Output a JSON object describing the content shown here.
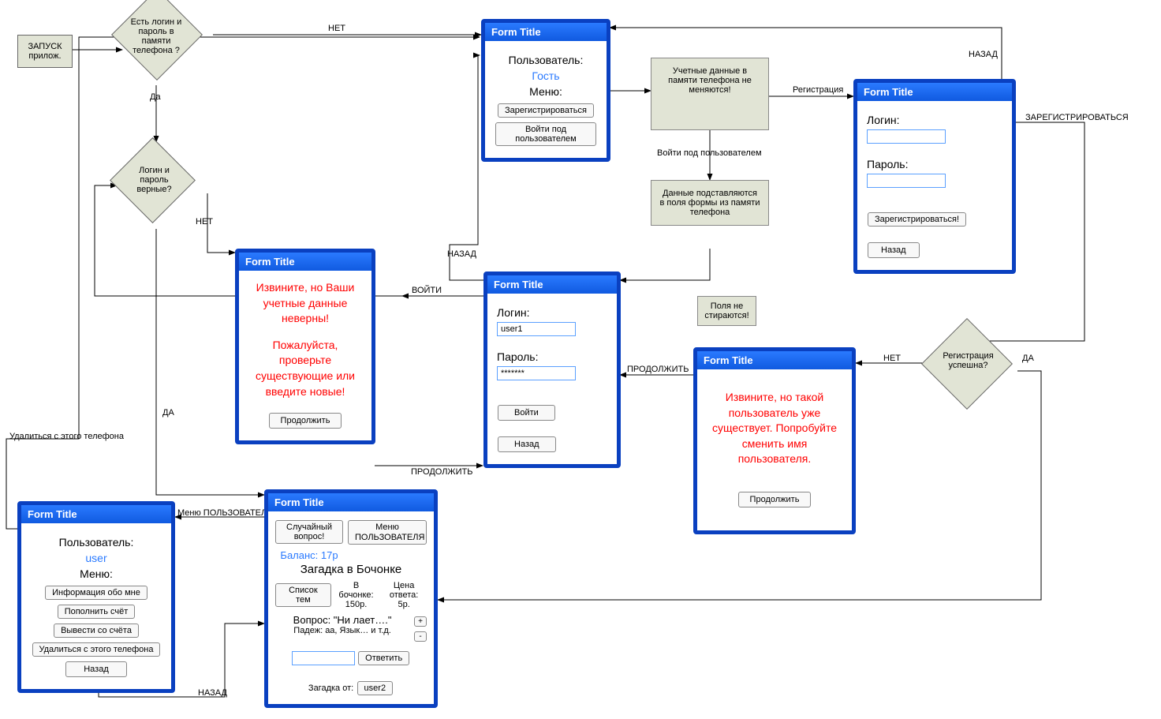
{
  "start_box": "ЗАПУСК прилож.",
  "diamonds": {
    "d1": "Есть логин и пароль в памяти телефона ?",
    "d2": "Логин и пароль верные?",
    "d3": "Регистрация успешна?"
  },
  "labels": {
    "net1": "НЕТ",
    "net2": "НЕТ",
    "net3": "НЕТ",
    "da1": "Да",
    "da2": "ДА",
    "da3": "ДА",
    "back1": "НАЗАД",
    "back2": "НАЗАД",
    "back3": "НАЗАД",
    "register_label": "Регистрация",
    "reg_action": "ЗАРЕГИСТРИРОВАТЬСЯ",
    "login_under_user": "Войти под пользователем",
    "enter": "ВОЙТИ",
    "continue": "ПРОДОЛЖИТЬ",
    "continue2": "ПРОДОЛЖИТЬ",
    "user_menu": "Меню ПОЛЬЗОВАТЕЛЯ",
    "delete_phone": "Удалиться с этого телефона",
    "fields_not_erased": "Поля не стираются!"
  },
  "notes": {
    "note1": "Учетные данные в памяти телефона не меняются!",
    "note2": "Данные подставляются в поля формы из памяти телефона"
  },
  "forms": {
    "guest": {
      "title": "Form Title",
      "user_label": "Пользователь:",
      "user_name": "Гость",
      "menu_label": "Меню:",
      "btn_register": "Зарегистрироваться",
      "btn_login": "Войти под пользователем"
    },
    "register": {
      "title": "Form Title",
      "login_label": "Логин:",
      "pass_label": "Пароль:",
      "btn_register": "Зарегистрироваться!",
      "btn_back": "Назад"
    },
    "invalid": {
      "title": "Form Title",
      "msg1": "Извините, но Ваши учетные данные неверны!",
      "msg2": "Пожалуйста, проверьте существующие или введите новые!",
      "btn_continue": "Продолжить"
    },
    "login": {
      "title": "Form Title",
      "login_label": "Логин:",
      "login_value": "user1",
      "pass_label": "Пароль:",
      "pass_value": "*******",
      "btn_login": "Войти",
      "btn_back": "Назад"
    },
    "user_exists": {
      "title": "Form Title",
      "msg": "Извините, но такой пользователь уже существует. Попробуйте сменить имя пользователя.",
      "btn_continue": "Продолжить"
    },
    "user_menu": {
      "title": "Form Title",
      "user_label": "Пользователь:",
      "user_name": "user",
      "menu_label": "Меню:",
      "btn_info": "Информация обо мне",
      "btn_deposit": "Пополнить счёт",
      "btn_withdraw": "Вывести со счёта",
      "btn_delete": "Удалиться с этого телефона",
      "btn_back": "Назад"
    },
    "game": {
      "title": "Form Title",
      "btn_random": "Случайный вопрос!",
      "btn_menu": "Меню ПОЛЬЗОВАТЕЛЯ",
      "balance": "Баланс: 17р",
      "riddle_title": "Загадка в Бочонке",
      "btn_topics": "Список тем",
      "barrel_label": "В бочонке:",
      "barrel_value": "150р.",
      "price_label": "Цена ответа:",
      "price_value": "5р.",
      "question": "Вопрос: \"Ни лает….\"",
      "hint": "Падеж: аа, Язык… и т.д.",
      "btn_plus": "+",
      "btn_minus": "-",
      "btn_answer": "Ответить",
      "from_label": "Загадка от:",
      "from_value": "user2"
    }
  }
}
